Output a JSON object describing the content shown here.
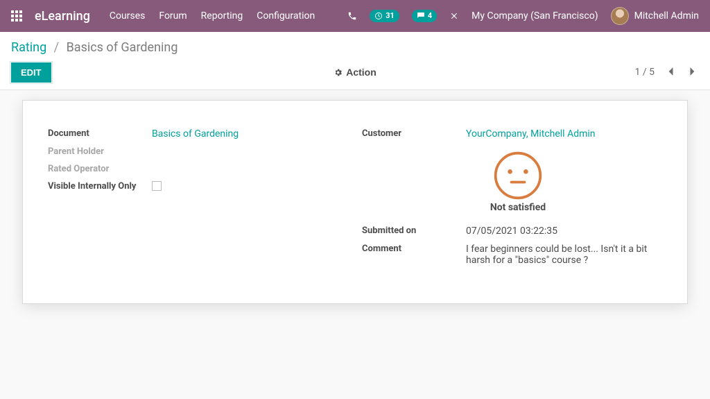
{
  "navbar": {
    "brand": "eLearning",
    "menu": [
      "Courses",
      "Forum",
      "Reporting",
      "Configuration"
    ],
    "clock_badge": "31",
    "chat_badge": "4",
    "company": "My Company (San Francisco)",
    "user": "Mitchell Admin"
  },
  "breadcrumb": {
    "parent": "Rating",
    "current": "Basics of Gardening"
  },
  "controls": {
    "edit": "EDIT",
    "action": "Action",
    "pager": "1 / 5"
  },
  "form": {
    "left": {
      "document_label": "Document",
      "document_value": "Basics of Gardening",
      "parent_holder_label": "Parent Holder",
      "rated_operator_label": "Rated Operator",
      "visible_internally_label": "Visible Internally Only"
    },
    "right": {
      "customer_label": "Customer",
      "customer_value": "YourCompany, Mitchell Admin",
      "rating_text": "Not satisfied",
      "submitted_label": "Submitted on",
      "submitted_value": "07/05/2021 03:22:35",
      "comment_label": "Comment",
      "comment_value": "I fear beginners could be lost... Isn't it a bit harsh for a \"basics\" course ?"
    }
  }
}
